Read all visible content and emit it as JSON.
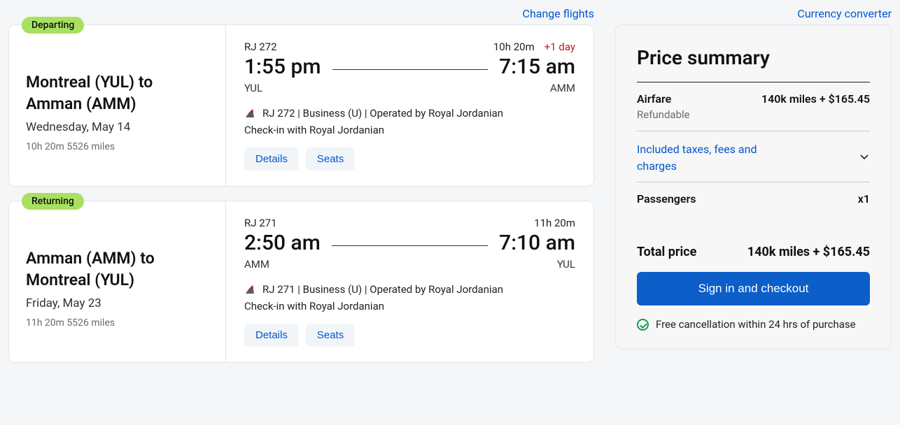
{
  "links": {
    "change_flights": "Change flights",
    "currency_converter": "Currency converter"
  },
  "departing": {
    "badge": "Departing",
    "route": "Montreal (YUL) to Amman (AMM)",
    "date": "Wednesday, May 14",
    "meta": "10h 20m  5526 miles",
    "flight_no_top": "RJ 272",
    "duration": "10h 20m",
    "plus_day": "+1 day",
    "dep_time": "1:55 pm",
    "arr_time": "7:15 am",
    "dep_code": "YUL",
    "arr_code": "AMM",
    "op_line": "RJ 272 | Business (U) | Operated by Royal Jordanian",
    "checkin": "Check-in with Royal Jordanian",
    "details": "Details",
    "seats": "Seats"
  },
  "returning": {
    "badge": "Returning",
    "route": "Amman (AMM) to Montreal (YUL)",
    "date": "Friday, May 23",
    "meta": "11h 20m  5526 miles",
    "flight_no_top": "RJ 271",
    "duration": "11h 20m",
    "dep_time": "2:50 am",
    "arr_time": "7:10 am",
    "dep_code": "AMM",
    "arr_code": "YUL",
    "op_line": "RJ 271 | Business (U) | Operated by Royal Jordanian",
    "checkin": "Check-in with Royal Jordanian",
    "details": "Details",
    "seats": "Seats"
  },
  "price": {
    "title": "Price summary",
    "airfare_label": "Airfare",
    "airfare_value": "140k miles + $165.45",
    "refundable": "Refundable",
    "taxes_label": "Included taxes, fees and charges",
    "passengers_label": "Passengers",
    "passengers_value": "x1",
    "total_label": "Total price",
    "total_value": "140k miles + $165.45",
    "cta": "Sign in and checkout",
    "cancellation": "Free cancellation within 24 hrs of purchase"
  }
}
